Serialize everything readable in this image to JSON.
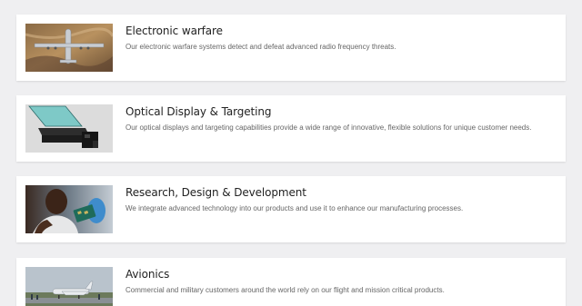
{
  "capabilities": [
    {
      "title": "Electronic warfare",
      "description": "Our electronic warfare systems detect and defeat advanced radio frequency threats.",
      "image_icon": "military-aircraft-image"
    },
    {
      "title": "Optical Display & Targeting",
      "description": "Our optical displays and targeting capabilities provide a wide range of innovative, flexible solutions for unique customer needs.",
      "image_icon": "heads-up-display-image"
    },
    {
      "title": "Research, Design & Development",
      "description": "We integrate advanced technology into our products and use it to enhance our manufacturing processes.",
      "image_icon": "engineer-with-circuit-board-image"
    },
    {
      "title": "Avionics",
      "description": "Commercial and military customers around the world rely on our flight and mission critical products.",
      "image_icon": "jet-on-runway-image"
    }
  ]
}
